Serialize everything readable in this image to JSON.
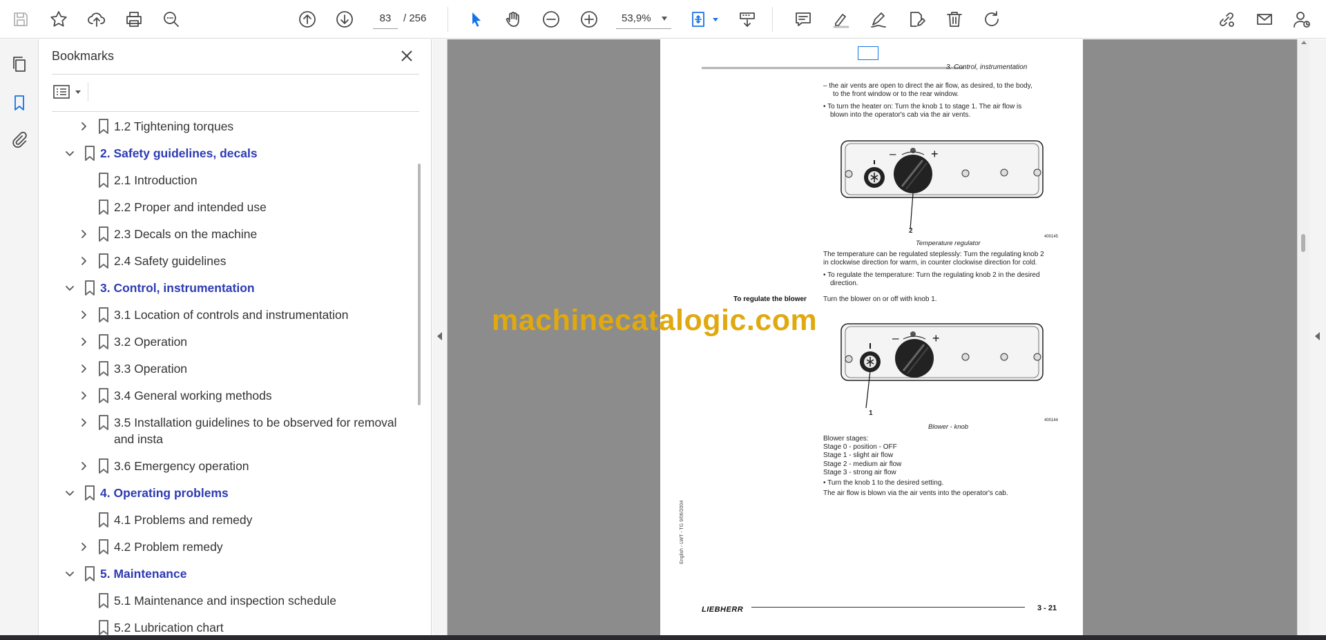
{
  "toolbar": {
    "page_current": "83",
    "page_total": "/  256",
    "zoom": "53,9%"
  },
  "panel": {
    "title": "Bookmarks",
    "bookmarks": [
      {
        "label": "1.2 Tightening torques",
        "level": 2,
        "expander": "collapsed"
      },
      {
        "label": "2. Safety guidelines, decals",
        "level": 1,
        "expander": "expanded"
      },
      {
        "label": "2.1 Introduction",
        "level": 2,
        "expander": "none"
      },
      {
        "label": "2.2 Proper and intended use",
        "level": 2,
        "expander": "none"
      },
      {
        "label": "2.3 Decals on the machine",
        "level": 2,
        "expander": "collapsed"
      },
      {
        "label": "2.4 Safety guidelines",
        "level": 2,
        "expander": "collapsed"
      },
      {
        "label": "3. Control, instrumentation",
        "level": 1,
        "expander": "expanded"
      },
      {
        "label": "3.1 Location of controls and instrumentation",
        "level": 2,
        "expander": "collapsed"
      },
      {
        "label": "3.2 Operation",
        "level": 2,
        "expander": "collapsed"
      },
      {
        "label": "3.3 Operation",
        "level": 2,
        "expander": "collapsed"
      },
      {
        "label": "3.4 General working methods",
        "level": 2,
        "expander": "collapsed"
      },
      {
        "label": "3.5 Installation guidelines to be observed for removal and insta",
        "level": 2,
        "expander": "collapsed"
      },
      {
        "label": "3.6 Emergency operation",
        "level": 2,
        "expander": "collapsed"
      },
      {
        "label": "4. Operating problems",
        "level": 1,
        "expander": "expanded"
      },
      {
        "label": "4.1 Problems and remedy",
        "level": 2,
        "expander": "none"
      },
      {
        "label": "4.2 Problem remedy",
        "level": 2,
        "expander": "collapsed"
      },
      {
        "label": "5. Maintenance",
        "level": 1,
        "expander": "expanded"
      },
      {
        "label": "5.1 Maintenance and inspection schedule",
        "level": 2,
        "expander": "none"
      },
      {
        "label": "5.2 Lubrication chart",
        "level": 2,
        "expander": "none"
      }
    ]
  },
  "document": {
    "header": "3. Control, instrumentation",
    "para1_line1": "–  the air vents are open to direct the air flow, as desired, to the body,",
    "para1_line2": "to the front window or to the rear window.",
    "para2_line1": "•  To turn the heater on: Turn the knob 1 to stage 1. The air flow is",
    "para2_line2": "blown into the operator's cab via the air vents.",
    "fig1_number": "2",
    "fig1_code": "400145",
    "fig1_caption": "Temperature regulator",
    "para3_line1": "The temperature can be regulated steplessly: Turn the regulating knob 2",
    "para3_line2": "in clockwise direction for warm, in counter clockwise direction for cold.",
    "para4_line1": "•  To regulate the temperature: Turn the regulating knob 2 in the desired",
    "para4_line2": "direction.",
    "side_label": "To regulate the blower",
    "para5": "Turn the blower on or off with knob 1.",
    "fig2_number": "1",
    "fig2_code": "400144",
    "fig2_caption": "Blower - knob",
    "stages_title": "Blower stages:",
    "stage0": "Stage 0  -  position  -  OFF",
    "stage1": "Stage 1  -  slight air flow",
    "stage2": "Stage 2  -  medium air flow",
    "stage3": "Stage 3  -  strong air flow",
    "bullet_final": "•  Turn the knob 1 to the desired setting.",
    "para_final": "The air flow is blown via the air vents into the operator's cab.",
    "vertical_note": "English - LWT - TG 9/06/2004",
    "logo": "LIEBHERR",
    "page_number": "3 - 21",
    "knob_minus": "–",
    "knob_plus": "+"
  },
  "watermark": "machinecatalogic.com",
  "colors": {
    "accent": "#1473e6",
    "bookmark_heading": "#2d3bb3",
    "watermark": "#e0a90f",
    "canvas": "#8c8c8c"
  }
}
